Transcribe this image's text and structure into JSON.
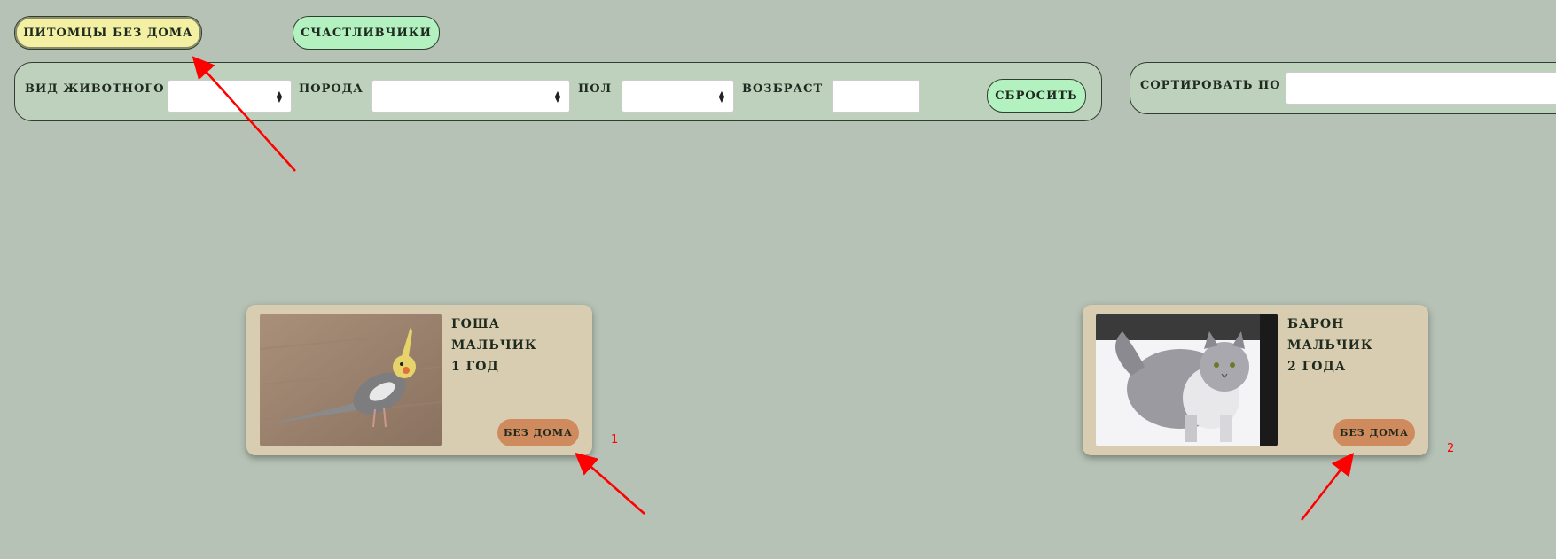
{
  "tabs": {
    "homeless_label": "питомцы без дома",
    "lucky_label": "счастливчики"
  },
  "filters": {
    "species_label": "вид животного",
    "species_value": "",
    "breed_label": "порода",
    "breed_value": "",
    "sex_label": "пол",
    "sex_value": "",
    "age_label": "возбраст",
    "age_value": "",
    "reset_label": "сбросить"
  },
  "sort": {
    "label": "сортировать по",
    "value": ""
  },
  "pets": [
    {
      "name": "гоша",
      "sex": "мальчик",
      "age": "1 год",
      "status": "без дома",
      "photo_icon": "cockatiel-photo"
    },
    {
      "name": "барон",
      "sex": "мальчик",
      "age": "2 года",
      "status": "без дома",
      "photo_icon": "cat-photo"
    }
  ],
  "annotations": {
    "marker_1": "1",
    "marker_2": "2",
    "arrow_color": "#ff0000"
  },
  "colors": {
    "background": "#b5c2b5",
    "tab_homeless": "#f3f0a3",
    "tab_lucky": "#b3f2c0",
    "card_bg": "#d8cdb0",
    "status_badge": "#cf8a5e"
  }
}
